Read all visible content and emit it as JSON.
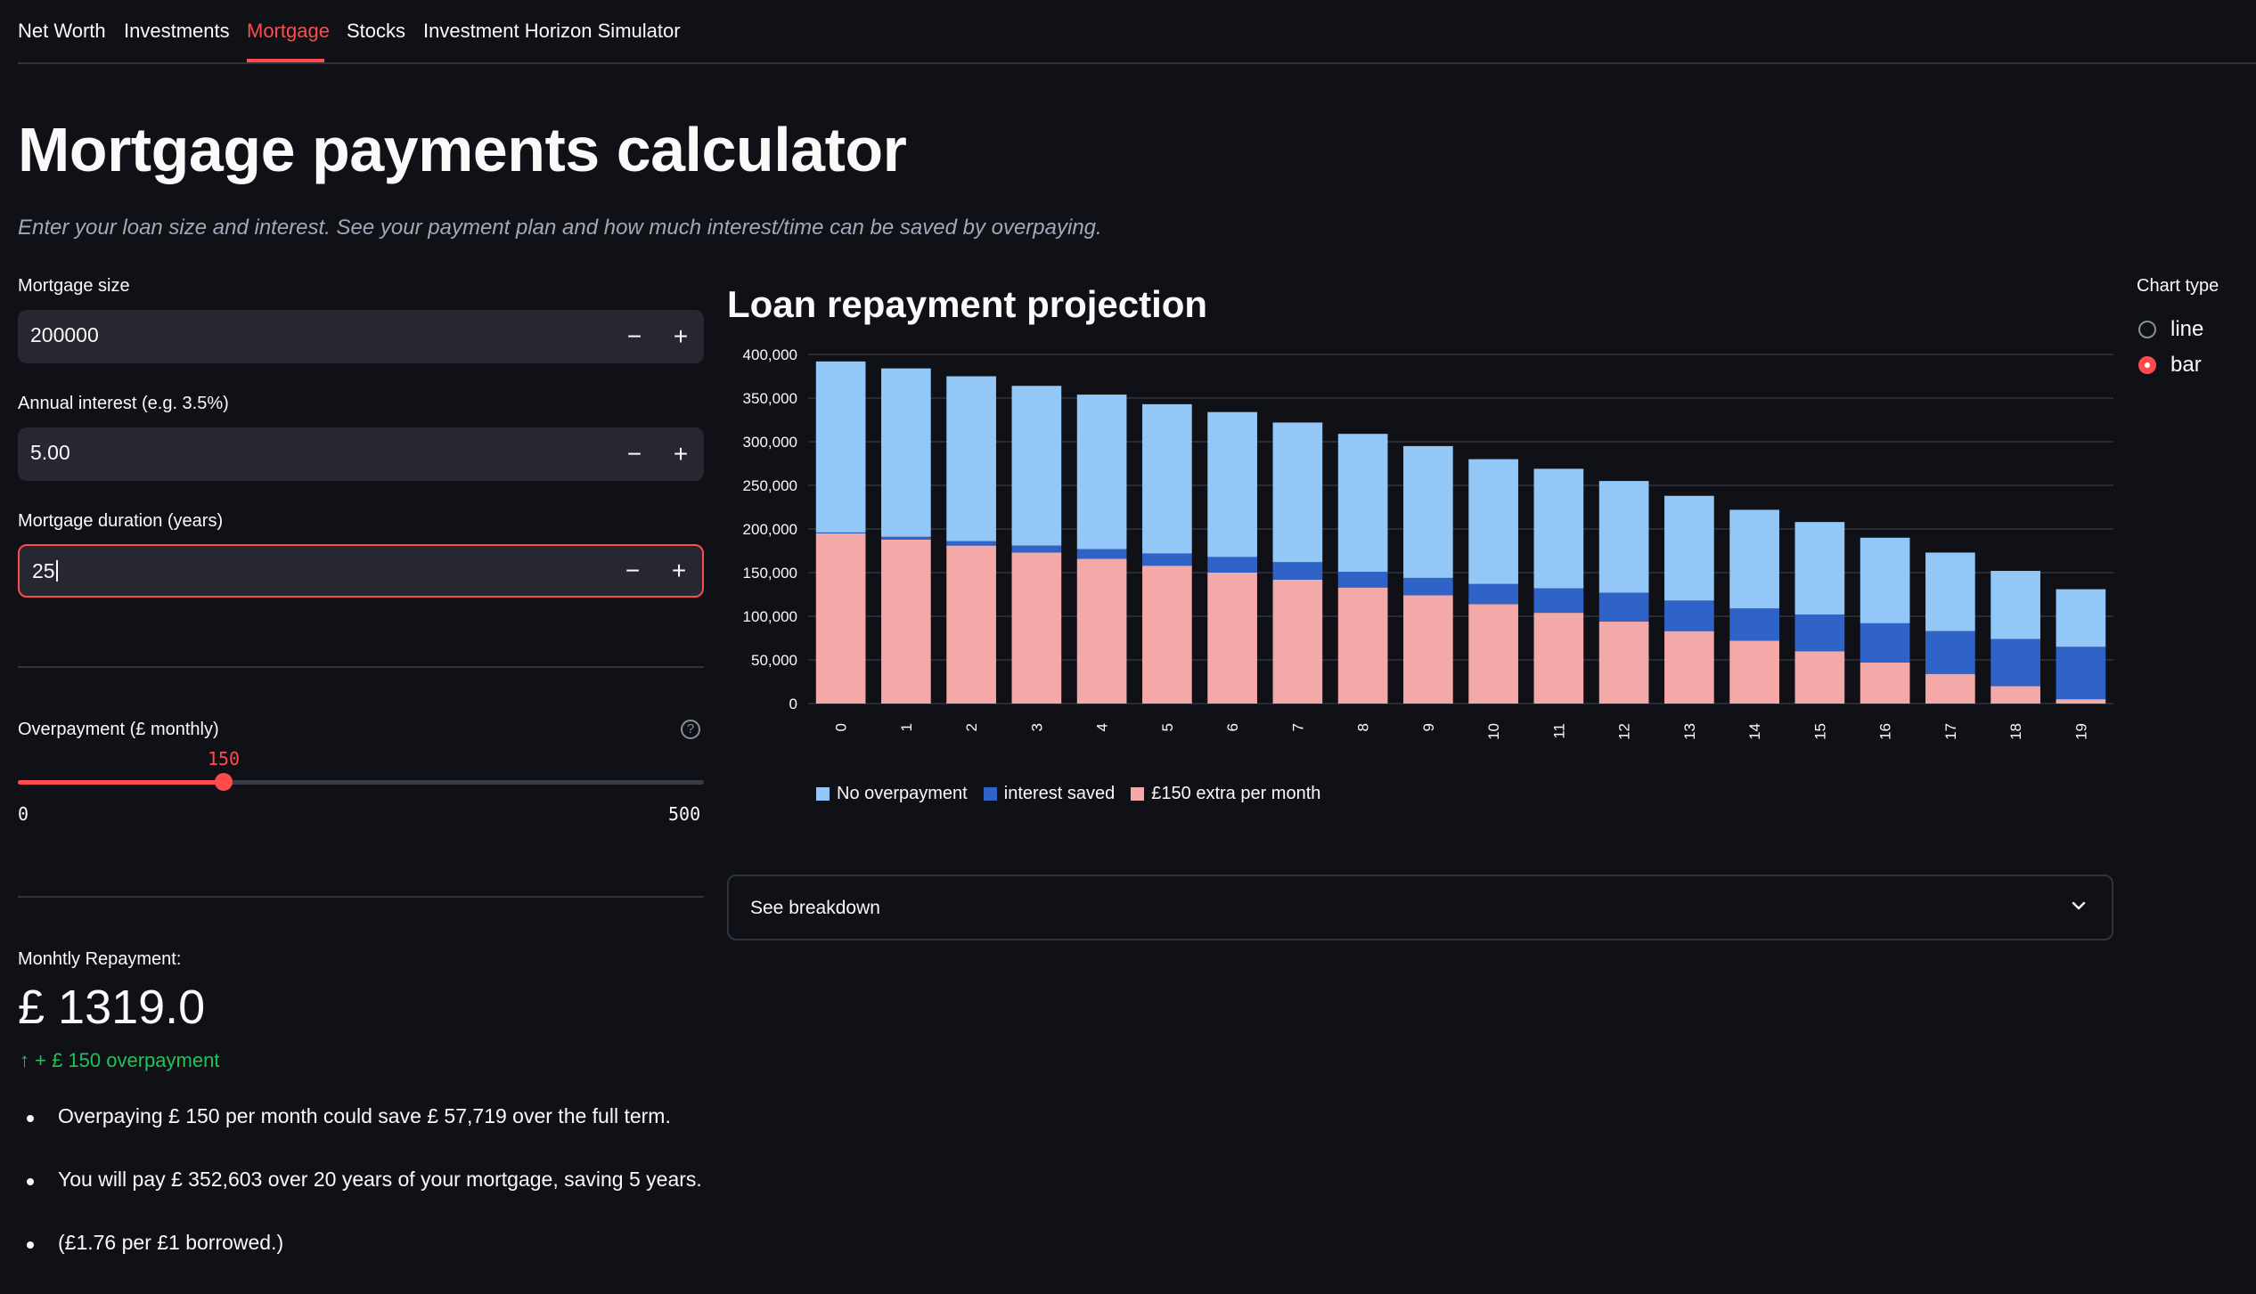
{
  "tabs": [
    "Net Worth",
    "Investments",
    "Mortgage",
    "Stocks",
    "Investment Horizon Simulator"
  ],
  "active_tab": "Mortgage",
  "page_title": "Mortgage payments calculator",
  "subtitle": "Enter your loan size and interest. See your payment plan and how much interest/time can be saved by overpaying.",
  "inputs": {
    "mortgage_size": {
      "label": "Mortgage size",
      "value": "200000"
    },
    "annual_interest": {
      "label": "Annual interest (e.g. 3.5%)",
      "value": "5.00"
    },
    "duration": {
      "label": "Mortgage duration (years)",
      "value": "25"
    },
    "minus": "−",
    "plus": "+"
  },
  "overpayment": {
    "label": "Overpayment (£ monthly)",
    "value": 150,
    "min": 0,
    "max": 500,
    "help_icon": "question-circle-icon"
  },
  "metric": {
    "label": "Monhtly Repayment:",
    "value": "£ 1319.0",
    "delta": "↑ + £ 150 overpayment"
  },
  "bullets": [
    "Overpaying £ 150 per month could save £ 57,719 over the full term.",
    "You will pay £ 352,603 over 20 years of your mortgage, saving 5 years.",
    "(£1.76 per £1 borrowed.)"
  ],
  "chart_title": "Loan repayment projection",
  "chart_data": {
    "type": "bar",
    "stacked": true,
    "categories": [
      "0",
      "1",
      "2",
      "3",
      "4",
      "5",
      "6",
      "7",
      "8",
      "9",
      "10",
      "11",
      "12",
      "13",
      "14",
      "15",
      "16",
      "17",
      "18",
      "19"
    ],
    "series": [
      {
        "name": "£150 extra per month",
        "color": "#f4a9a9",
        "values": [
          195000,
          188000,
          181000,
          173000,
          166000,
          158000,
          150000,
          142000,
          133000,
          124000,
          114000,
          104000,
          94000,
          83000,
          72000,
          60000,
          47000,
          34000,
          20000,
          5000
        ]
      },
      {
        "name": "interest saved",
        "color": "#2f63c8",
        "values": [
          1000,
          3000,
          5000,
          8000,
          11000,
          14000,
          18000,
          20000,
          18000,
          20000,
          23000,
          28000,
          33000,
          35000,
          37000,
          42000,
          45000,
          49000,
          54000,
          60000
        ]
      },
      {
        "name": "No overpayment",
        "color": "#93c7f7",
        "values": [
          196000,
          193000,
          189000,
          183000,
          177000,
          171000,
          166000,
          160000,
          158000,
          151000,
          143000,
          137000,
          128000,
          120000,
          113000,
          106000,
          98000,
          90000,
          78000,
          66000
        ]
      }
    ],
    "legend_order": [
      "No overpayment",
      "interest saved",
      "£150 extra per month"
    ],
    "y_ticks": [
      0,
      50000,
      100000,
      150000,
      200000,
      250000,
      300000,
      350000,
      400000
    ],
    "y_tick_labels": [
      "0",
      "50,000",
      "100,000",
      "150,000",
      "200,000",
      "250,000",
      "300,000",
      "350,000",
      "400,000"
    ],
    "ylim": [
      0,
      400000
    ],
    "grid": true,
    "legend_position": "bottom-left"
  },
  "expander_label": "See breakdown",
  "expander_icon": "chevron-down-icon",
  "chart_type": {
    "label": "Chart type",
    "options": [
      "line",
      "bar"
    ],
    "selected": "bar"
  }
}
